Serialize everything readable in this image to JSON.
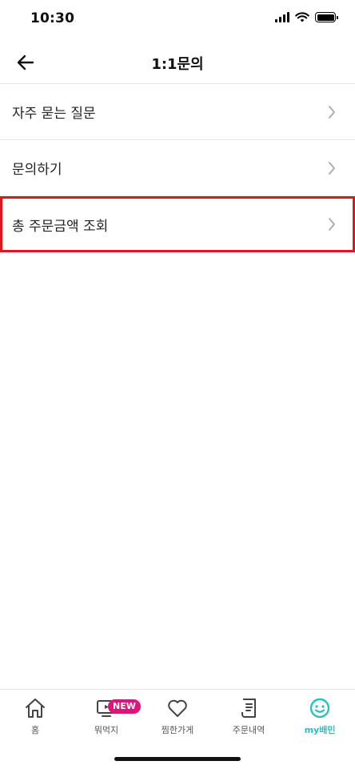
{
  "status_bar": {
    "time": "10:30"
  },
  "header": {
    "title": "1:1문의"
  },
  "menu": {
    "items": [
      {
        "label": "자주 묻는 질문"
      },
      {
        "label": "문의하기"
      },
      {
        "label": "총 주문금액 조회"
      }
    ]
  },
  "tab_bar": {
    "tabs": [
      {
        "label": "홈",
        "icon": "home-icon"
      },
      {
        "label": "뭐먹지",
        "icon": "tv-icon",
        "badge": "NEW"
      },
      {
        "label": "찜한가게",
        "icon": "heart-icon"
      },
      {
        "label": "주문내역",
        "icon": "receipt-icon"
      },
      {
        "label": "my배민",
        "icon": "smile-icon",
        "active": true
      }
    ]
  },
  "colors": {
    "accent": "#2ac1bc",
    "badge": "#e0127b",
    "highlight_border": "#e0161c"
  }
}
